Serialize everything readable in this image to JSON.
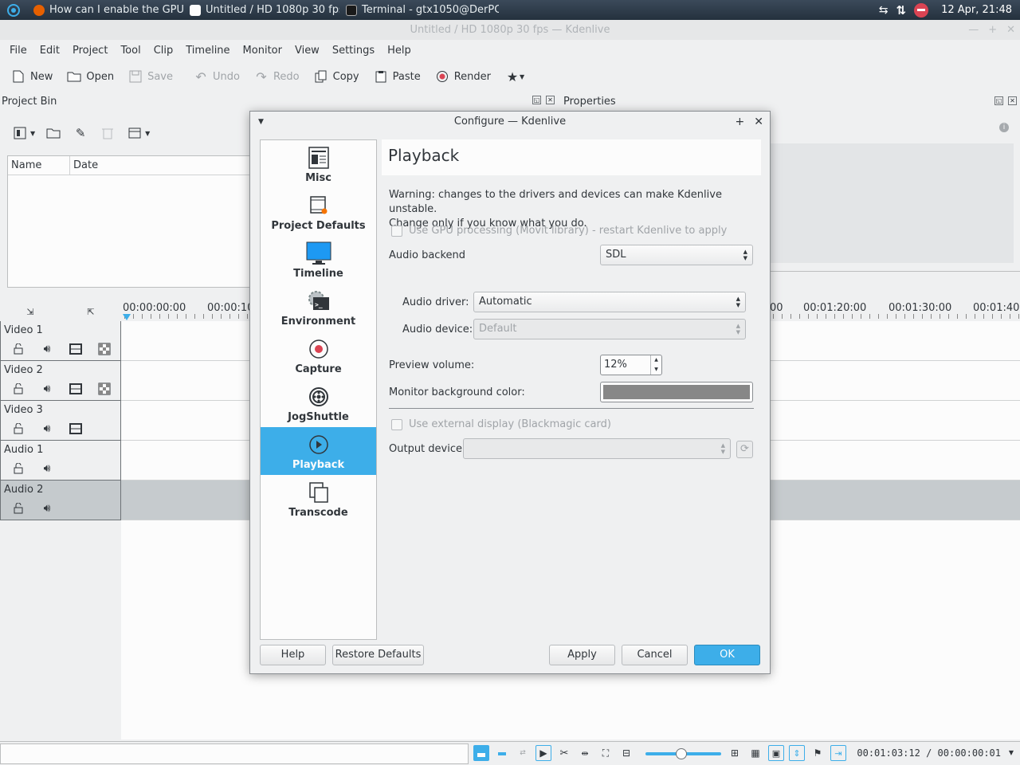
{
  "taskbar": {
    "tasks": [
      {
        "label": "How can I enable the GPU ...",
        "color": "#e66000"
      },
      {
        "label": "Untitled / HD 1080p 30 fps ...",
        "color": "#fcfcfc"
      },
      {
        "label": "Terminal - gtx1050@DerPC...",
        "color": "#31363b"
      }
    ],
    "clock": "12 Apr, 21:48"
  },
  "window": {
    "title": "Untitled / HD 1080p 30 fps — Kdenlive"
  },
  "menu": [
    "File",
    "Edit",
    "Project",
    "Tool",
    "Clip",
    "Timeline",
    "Monitor",
    "View",
    "Settings",
    "Help"
  ],
  "toolbar": {
    "new": "New",
    "open": "Open",
    "save": "Save",
    "undo": "Undo",
    "redo": "Redo",
    "copy": "Copy",
    "paste": "Paste",
    "render": "Render"
  },
  "project_bin": {
    "title": "Project Bin",
    "col_name": "Name",
    "col_date": "Date"
  },
  "properties": {
    "title": "Properties"
  },
  "timeline": {
    "ruler_labels": [
      "00:00:00:00",
      "00:00:10",
      "00",
      "00:01:20:00",
      "00:01:30:00",
      "00:01:40"
    ],
    "tracks": [
      {
        "name": "Video 1"
      },
      {
        "name": "Video 2"
      },
      {
        "name": "Video 3"
      },
      {
        "name": "Audio 1"
      },
      {
        "name": "Audio 2"
      }
    ]
  },
  "status": {
    "timecode": "00:01:03:12 / 00:00:00:01"
  },
  "dialog": {
    "title": "Configure — Kdenlive",
    "sidebar": [
      "Misc",
      "Project Defaults",
      "Timeline",
      "Environment",
      "Capture",
      "JogShuttle",
      "Playback",
      "Transcode"
    ],
    "active": "Playback",
    "page_title": "Playback",
    "warning_line1": "Warning: changes to the drivers and devices can make Kdenlive unstable.",
    "warning_line2": "Change only if you know what you do.",
    "gpu_checkbox": "Use GPU processing (Movit library) - restart Kdenlive to apply",
    "audio_backend_label": "Audio backend",
    "audio_backend_value": "SDL",
    "audio_driver_label": "Audio driver:",
    "audio_driver_value": "Automatic",
    "audio_device_label": "Audio device:",
    "audio_device_value": "Default",
    "preview_volume_label": "Preview volume:",
    "preview_volume_value": "12%",
    "monitor_bg_label": "Monitor background color:",
    "monitor_bg_color": "#878787",
    "external_display_checkbox": "Use external display (Blackmagic card)",
    "output_device_label": "Output device",
    "output_device_value": "",
    "buttons": {
      "help": "Help",
      "restore": "Restore Defaults",
      "apply": "Apply",
      "cancel": "Cancel",
      "ok": "OK"
    }
  },
  "colors": {
    "accent": "#3daee9",
    "record": "#da4453"
  }
}
